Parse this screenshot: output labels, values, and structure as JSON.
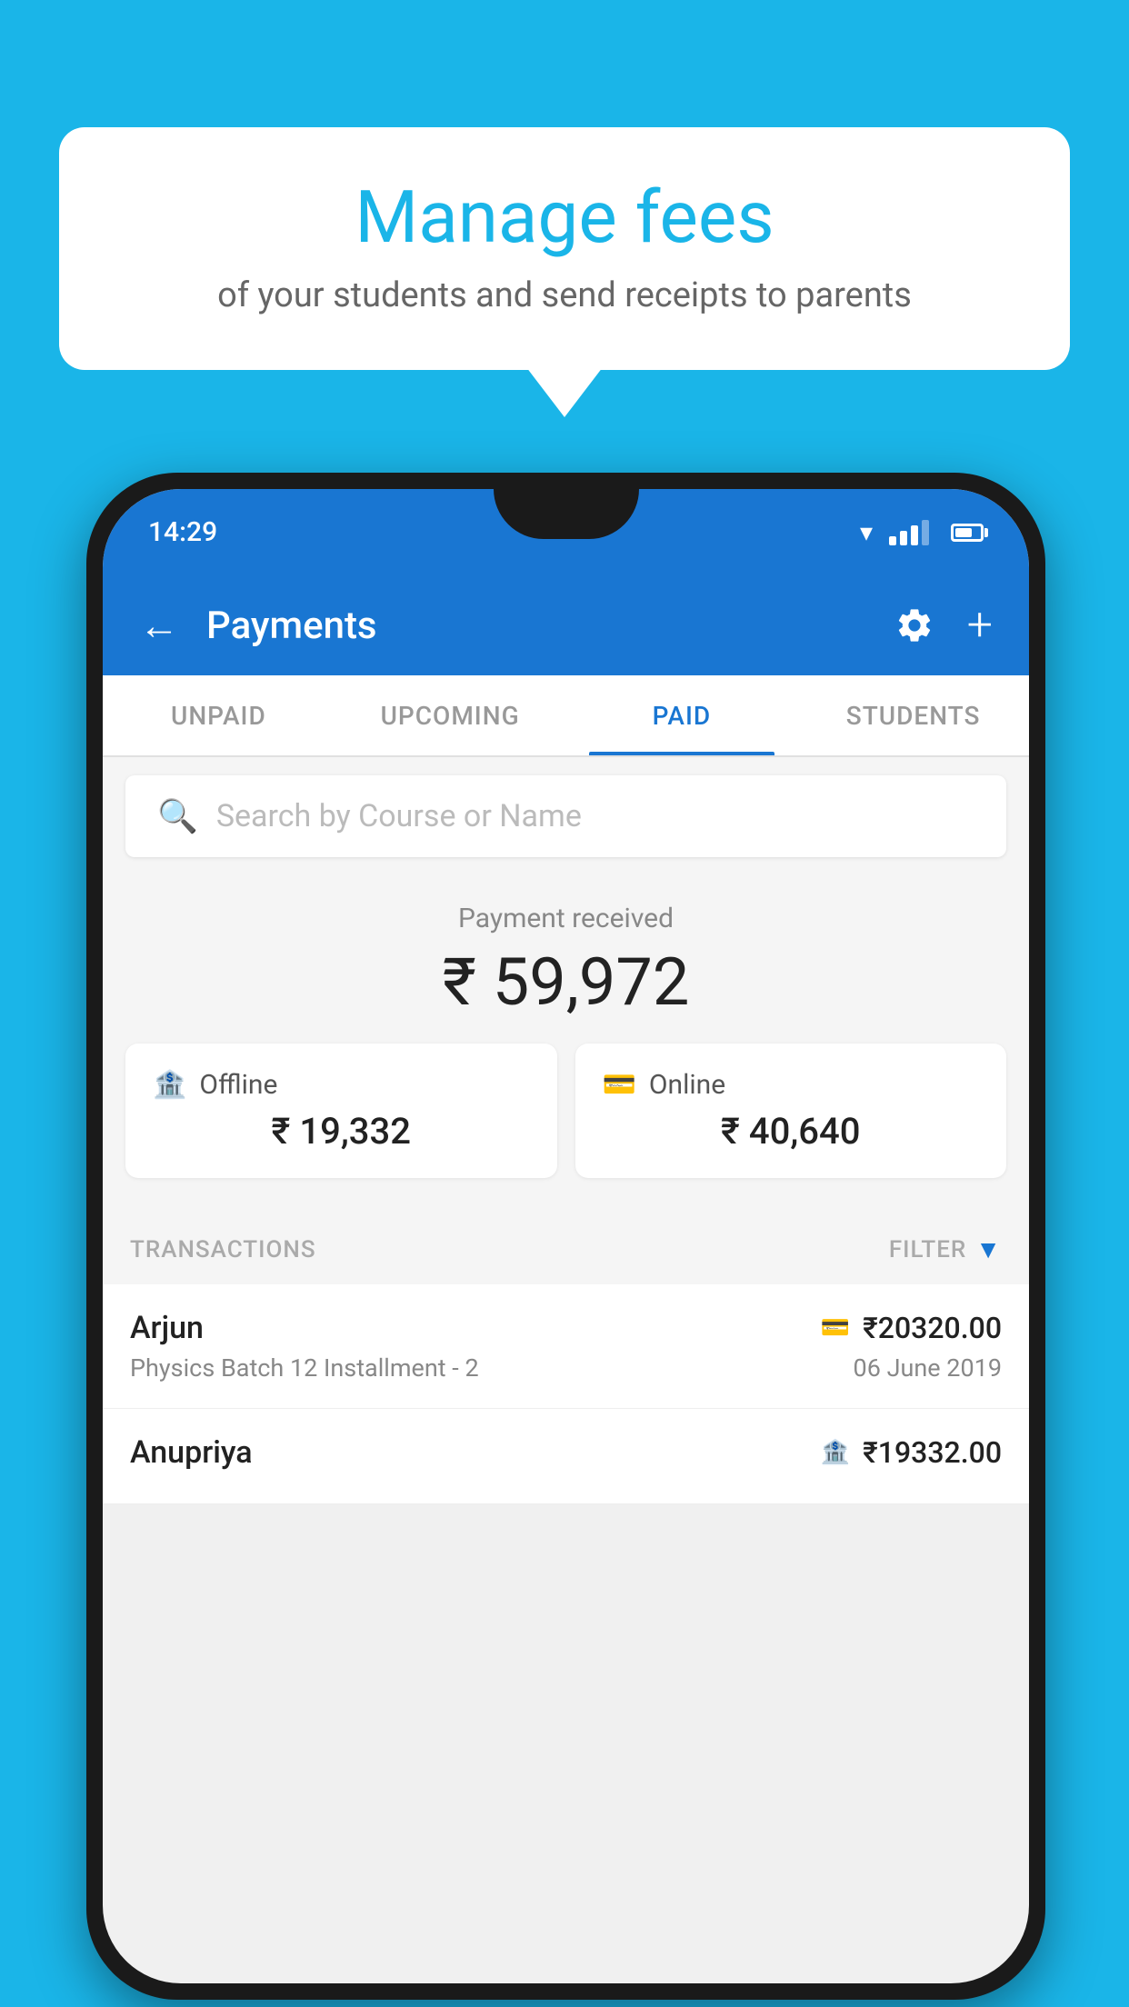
{
  "background_color": "#1ab5e8",
  "bubble": {
    "title": "Manage fees",
    "subtitle": "of your students and send receipts to parents"
  },
  "status_bar": {
    "time": "14:29"
  },
  "app_bar": {
    "title": "Payments",
    "back_label": "←",
    "plus_label": "+"
  },
  "tabs": [
    {
      "label": "UNPAID",
      "active": false
    },
    {
      "label": "UPCOMING",
      "active": false
    },
    {
      "label": "PAID",
      "active": true
    },
    {
      "label": "STUDENTS",
      "active": false
    }
  ],
  "search": {
    "placeholder": "Search by Course or Name"
  },
  "payment_summary": {
    "received_label": "Payment received",
    "total_amount": "₹ 59,972",
    "offline_label": "Offline",
    "offline_amount": "₹ 19,332",
    "online_label": "Online",
    "online_amount": "₹ 40,640"
  },
  "transactions_section": {
    "label": "TRANSACTIONS",
    "filter_label": "FILTER"
  },
  "transactions": [
    {
      "name": "Arjun",
      "course": "Physics Batch 12 Installment - 2",
      "amount": "₹20320.00",
      "date": "06 June 2019",
      "type": "card"
    },
    {
      "name": "Anupriya",
      "course": "",
      "amount": "₹19332.00",
      "date": "",
      "type": "offline"
    }
  ]
}
